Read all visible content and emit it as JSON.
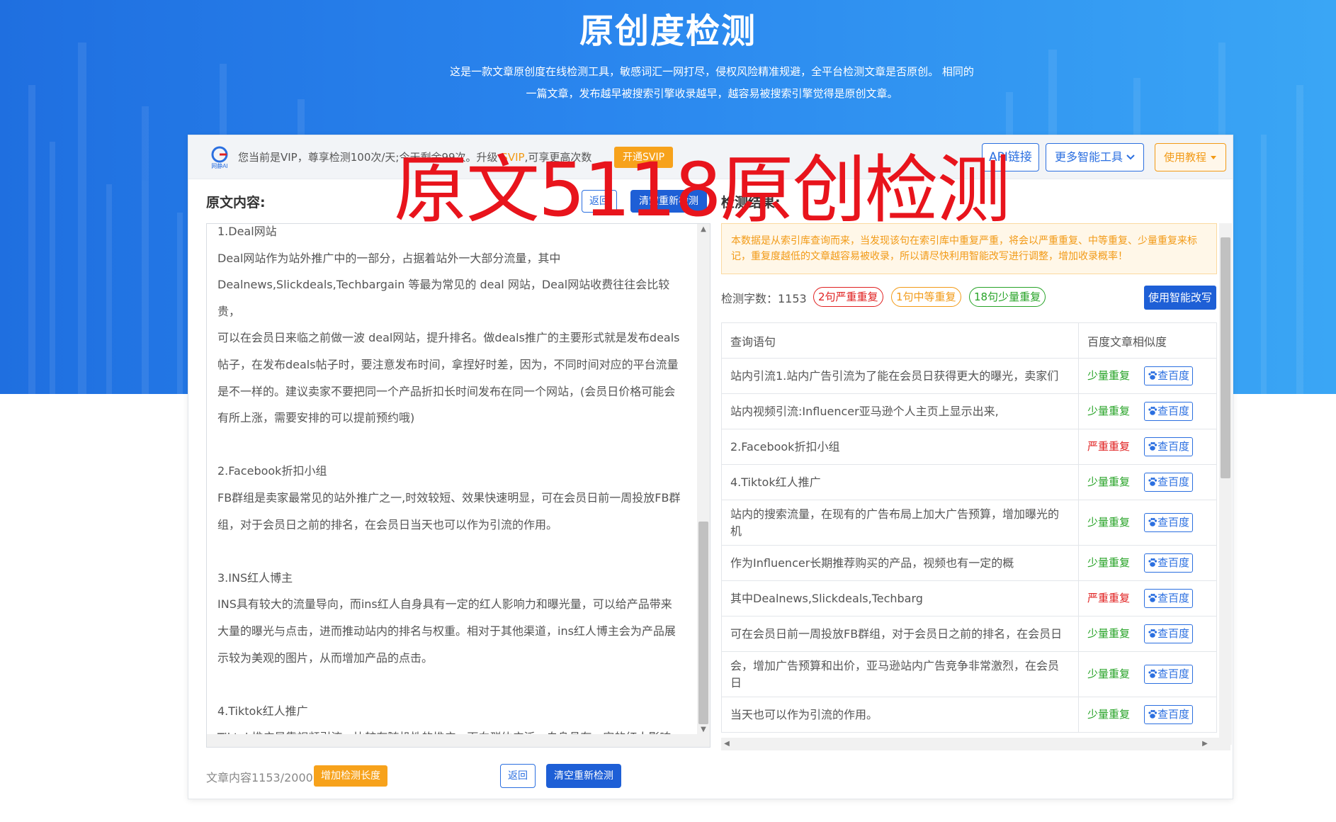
{
  "hero": {
    "title": "原创度检测",
    "desc": "这是一款文章原创度在线检测工具，敏感词汇一网打尽，侵权风险精准规避，全平台检测文章是否原创。 相同的一篇文章，发布越早被搜索引擎收录越早，越容易被搜索引擎觉得是原创文章。"
  },
  "topbar": {
    "vip_prefix": "您当前是VIP，尊享检测100次/天;今天剩余99次。升级 ",
    "vip_svip": "SVIP",
    "vip_suffix": ",可享更高次数",
    "btn_svip": "开通SVIP",
    "btn_api": "API链接",
    "btn_more": "更多智能工具",
    "btn_tutorial": "使用教程"
  },
  "original": {
    "label": "原文内容:",
    "btn_back": "返回",
    "btn_clear": "清空重新检测",
    "text": "1.Deal网站\nDeal网站作为站外推广中的一部分，占据着站外一大部分流量，其中\nDealnews,Slickdeals,Techbargain 等最为常见的 deal 网站，Deal网站收费往往会比较贵，\n可以在会员日来临之前做一波 deal网站，提升排名。做deals推广的主要形式就是发布deals\n帖子，在发布deals帖子时，要注意发布时间，拿捏好时差，因为，不同时间对应的平台流量\n是不一样的。建议卖家不要把同一个产品折扣长时间发布在同一个网站，(会员日价格可能会\n有所上涨，需要安排的可以提前预约哦)\n\n2.Facebook折扣小组\nFB群组是卖家最常见的站外推广之一,时效较短、效果快速明显，可在会员日前一周投放FB群\n组，对于会员日之前的排名，在会员日当天也可以作为引流的作用。\n\n3.INS红人博主\nINS具有较大的流量导向，而ins红人自身具有一定的红人影响力和曝光量，可以给产品带来\n大量的曝光与点击，进而推动站内的排名与权重。相对于其他渠道，ins红人博主会为产品展\n示较为美观的图片，从而增加产品的点击。\n\n4.Tiktok红人推广\nTiktok推广是靠视频引流，比较有随机性的推广，面向群体广泛，自身具有一定的红人影响\n力和曝光量，能够很大程度的提高流量。"
  },
  "result": {
    "label": "检测结果:",
    "notice": "本数据是从索引库查询而来，当发现该句在索引库中重复严重，将会以严重重复、中等重复、少量重复来标记，重复度越低的文章越容易被收录，所以请尽快利用智能改写进行调整，增加收录概率！",
    "count_label": "检测字数：1153",
    "pill_severe": "2句严重重复",
    "pill_medium": "1句中等重复",
    "pill_light": "18句少量重复",
    "btn_ai": "使用智能改写",
    "col_query": "查询语句",
    "col_similarity": "百度文章相似度",
    "btn_baidu": "查百度",
    "rows": [
      {
        "sentence": "站内引流1.站内广告引流为了能在会员日获得更大的曝光，卖家们",
        "level": "少量重复",
        "severity": "light"
      },
      {
        "sentence": "站内视频引流:Influencer亚马逊个人主页上显示出来,",
        "level": "少量重复",
        "severity": "light"
      },
      {
        "sentence": "2.Facebook折扣小组",
        "level": "严重重复",
        "severity": "severe"
      },
      {
        "sentence": "4.Tiktok红人推广",
        "level": "少量重复",
        "severity": "light"
      },
      {
        "sentence": "站内的搜索流量，在现有的广告布局上加大广告预算，增加曝光的机",
        "level": "少量重复",
        "severity": "light"
      },
      {
        "sentence": "作为Influencer长期推荐购买的产品，视频也有一定的概",
        "level": "少量重复",
        "severity": "light"
      },
      {
        "sentence": "其中Dealnews,Slickdeals,Techbarg",
        "level": "严重重复",
        "severity": "severe"
      },
      {
        "sentence": "可在会员日前一周投放FB群组，对于会员日之前的排名，在会员日",
        "level": "少量重复",
        "severity": "light"
      },
      {
        "sentence": "会，增加广告预算和出价，亚马逊站内广告竞争非常激烈，在会员日",
        "level": "少量重复",
        "severity": "light"
      },
      {
        "sentence": "当天也可以作为引流的作用。",
        "level": "少量重复",
        "severity": "light"
      }
    ]
  },
  "bottom": {
    "word_count": "文章内容1153/2000",
    "btn_length": "增加检测长度",
    "btn_back": "返回",
    "btn_clear": "清空重新检测"
  },
  "watermark": "原文5118原创检测",
  "colors": {
    "brand_blue": "#1e5fd6",
    "orange": "#f7a21b",
    "severe_red": "#e02020",
    "light_green": "#27a327"
  }
}
